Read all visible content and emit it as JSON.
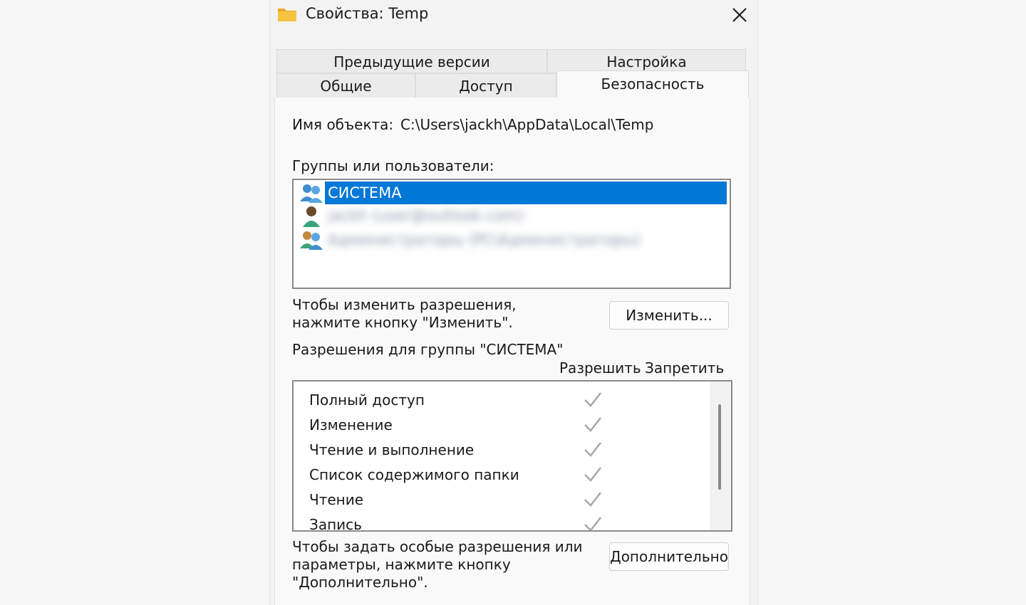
{
  "window": {
    "title": "Свойства: Temp"
  },
  "tabs": {
    "row1": [
      {
        "label": "Предыдущие версии"
      },
      {
        "label": "Настройка"
      }
    ],
    "row2": [
      {
        "label": "Общие"
      },
      {
        "label": "Доступ"
      },
      {
        "label": "Безопасность",
        "active": true
      }
    ]
  },
  "security": {
    "object_label": "Имя объекта:",
    "object_path": "C:\\Users\\jackh\\AppData\\Local\\Temp",
    "groups_label": "Группы или пользователи:",
    "users": [
      {
        "name": "СИСТЕМА",
        "icon": "user-group-icon",
        "selected": true
      },
      {
        "name": "jackh (user@outlook.com)",
        "icon": "user-icon",
        "blurred": true
      },
      {
        "name": "Администраторы (PC\\Администраторы)",
        "icon": "user-group-icon",
        "blurred": true
      }
    ],
    "change_hint_1": "Чтобы изменить разрешения,",
    "change_hint_2": "нажмите кнопку \"Изменить\".",
    "change_button": "Изменить...",
    "permissions_label": "Разрешения для группы \"СИСТЕМА\"",
    "allow_header": "Разрешить",
    "deny_header": "Запретить",
    "permissions": [
      {
        "name": "Полный доступ",
        "allow": true
      },
      {
        "name": "Изменение",
        "allow": true
      },
      {
        "name": "Чтение и выполнение",
        "allow": true
      },
      {
        "name": "Список содержимого папки",
        "allow": true
      },
      {
        "name": "Чтение",
        "allow": true
      },
      {
        "name": "Запись",
        "allow": true
      }
    ],
    "advanced_hint_1": "Чтобы задать особые разрешения или",
    "advanced_hint_2": "параметры, нажмите кнопку",
    "advanced_hint_3": "\"Дополнительно\".",
    "advanced_button": "Дополнительно"
  },
  "colors": {
    "selection": "#0078d7",
    "check": "#a8a8a8",
    "folder": "#f5c342"
  }
}
